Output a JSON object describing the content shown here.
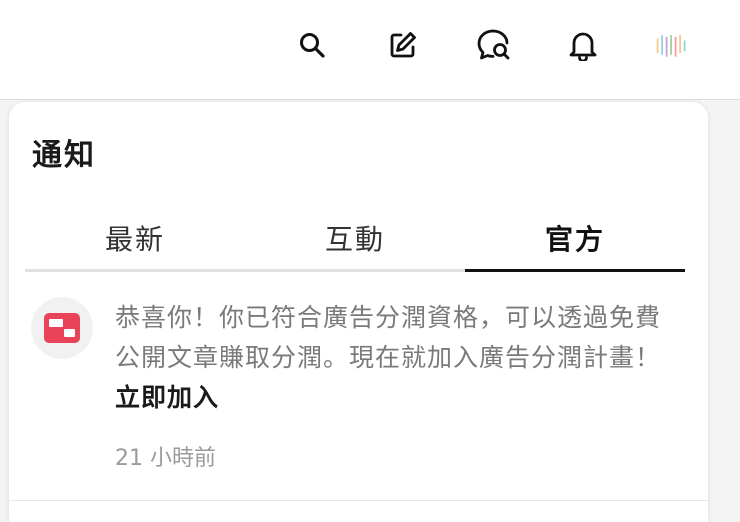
{
  "topbar": {
    "icons": [
      "search-icon",
      "edit-icon",
      "chat-search-icon",
      "bell-icon",
      "avatar"
    ],
    "avatar_colors": [
      "#f3c98b",
      "#8fd3e8",
      "#c8a0e0",
      "#9ed39b",
      "#f0a0a0"
    ]
  },
  "panel": {
    "title": "通知"
  },
  "tabs": [
    {
      "label": "最新"
    },
    {
      "label": "互動"
    },
    {
      "label": "官方"
    }
  ],
  "active_tab": "官方",
  "notification": {
    "icon": "ad-revenue-icon",
    "icon_color": "#e9435a",
    "message": "恭喜你！你已符合廣告分潤資格，可以透過免費公開文章賺取分潤。現在就加入廣告分潤計畫！",
    "cta": "立即加入",
    "time": "21 小時前"
  }
}
